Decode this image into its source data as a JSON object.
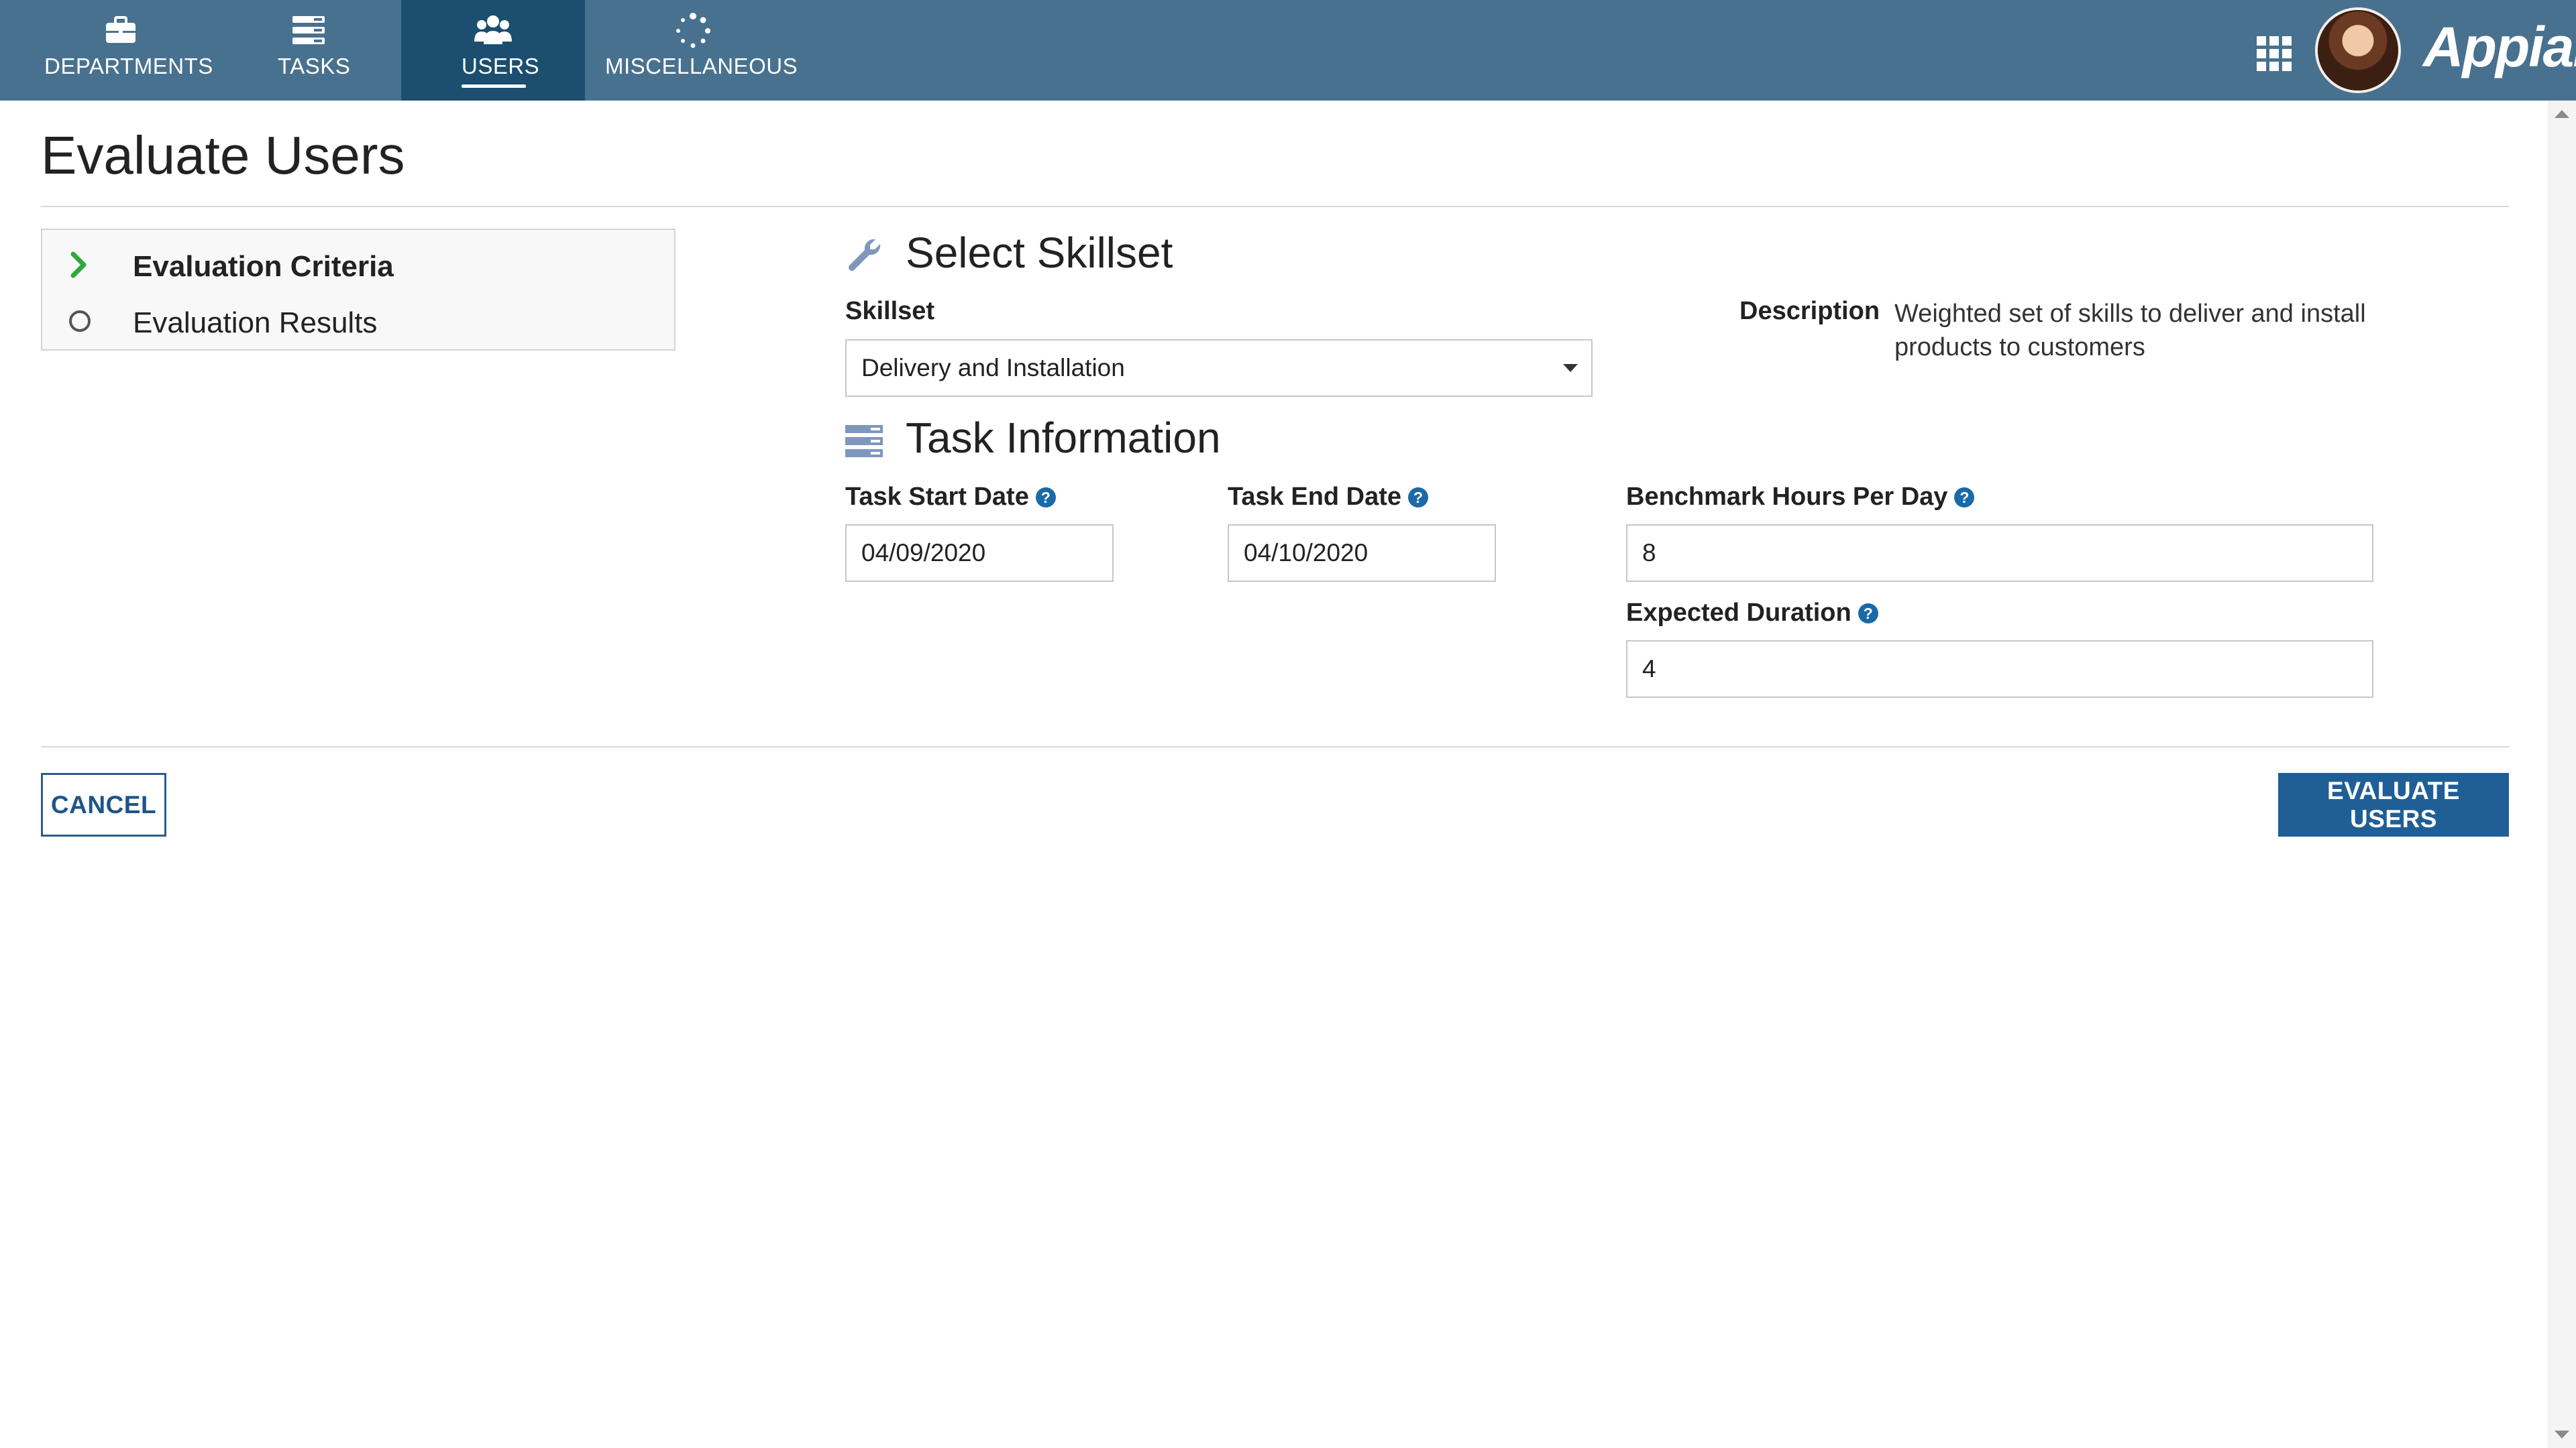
{
  "nav": {
    "tabs": [
      {
        "label": "DEPARTMENTS",
        "icon": "briefcase-icon",
        "active": false
      },
      {
        "label": "TASKS",
        "icon": "tasks-icon",
        "active": false
      },
      {
        "label": "USERS",
        "icon": "users-icon",
        "active": true
      },
      {
        "label": "MISCELLANEOUS",
        "icon": "spinner-icon",
        "active": false
      }
    ],
    "apps_icon": "grid-icon",
    "avatar": "user-avatar",
    "logo": "Appian",
    "bar_color": "#48718f",
    "active_color": "#1b4e6f"
  },
  "page": {
    "title": "Evaluate Users"
  },
  "steps": [
    {
      "label": "Evaluation Criteria",
      "state": "current",
      "icon": "chevron-right-icon"
    },
    {
      "label": "Evaluation Results",
      "state": "pending",
      "icon": "circle-icon"
    }
  ],
  "skillset_section": {
    "title": "Select Skillset",
    "icon": "wrench-icon",
    "skillset_label": "Skillset",
    "skillset_value": "Delivery and Installation",
    "description_label": "Description",
    "description_value": "Weighted set of skills to deliver and install products to customers"
  },
  "task_section": {
    "title": "Task Information",
    "icon": "list-icon",
    "start_label": "Task Start Date",
    "start_value": "04/09/2020",
    "end_label": "Task End Date",
    "end_value": "04/10/2020",
    "hours_label": "Benchmark Hours Per Day",
    "hours_value": "8",
    "duration_label": "Expected Duration",
    "duration_value": "4",
    "help_glyph": "?"
  },
  "buttons": {
    "cancel": "CANCEL",
    "evaluate": "EVALUATE USERS",
    "primary_color": "#1f5f95"
  }
}
